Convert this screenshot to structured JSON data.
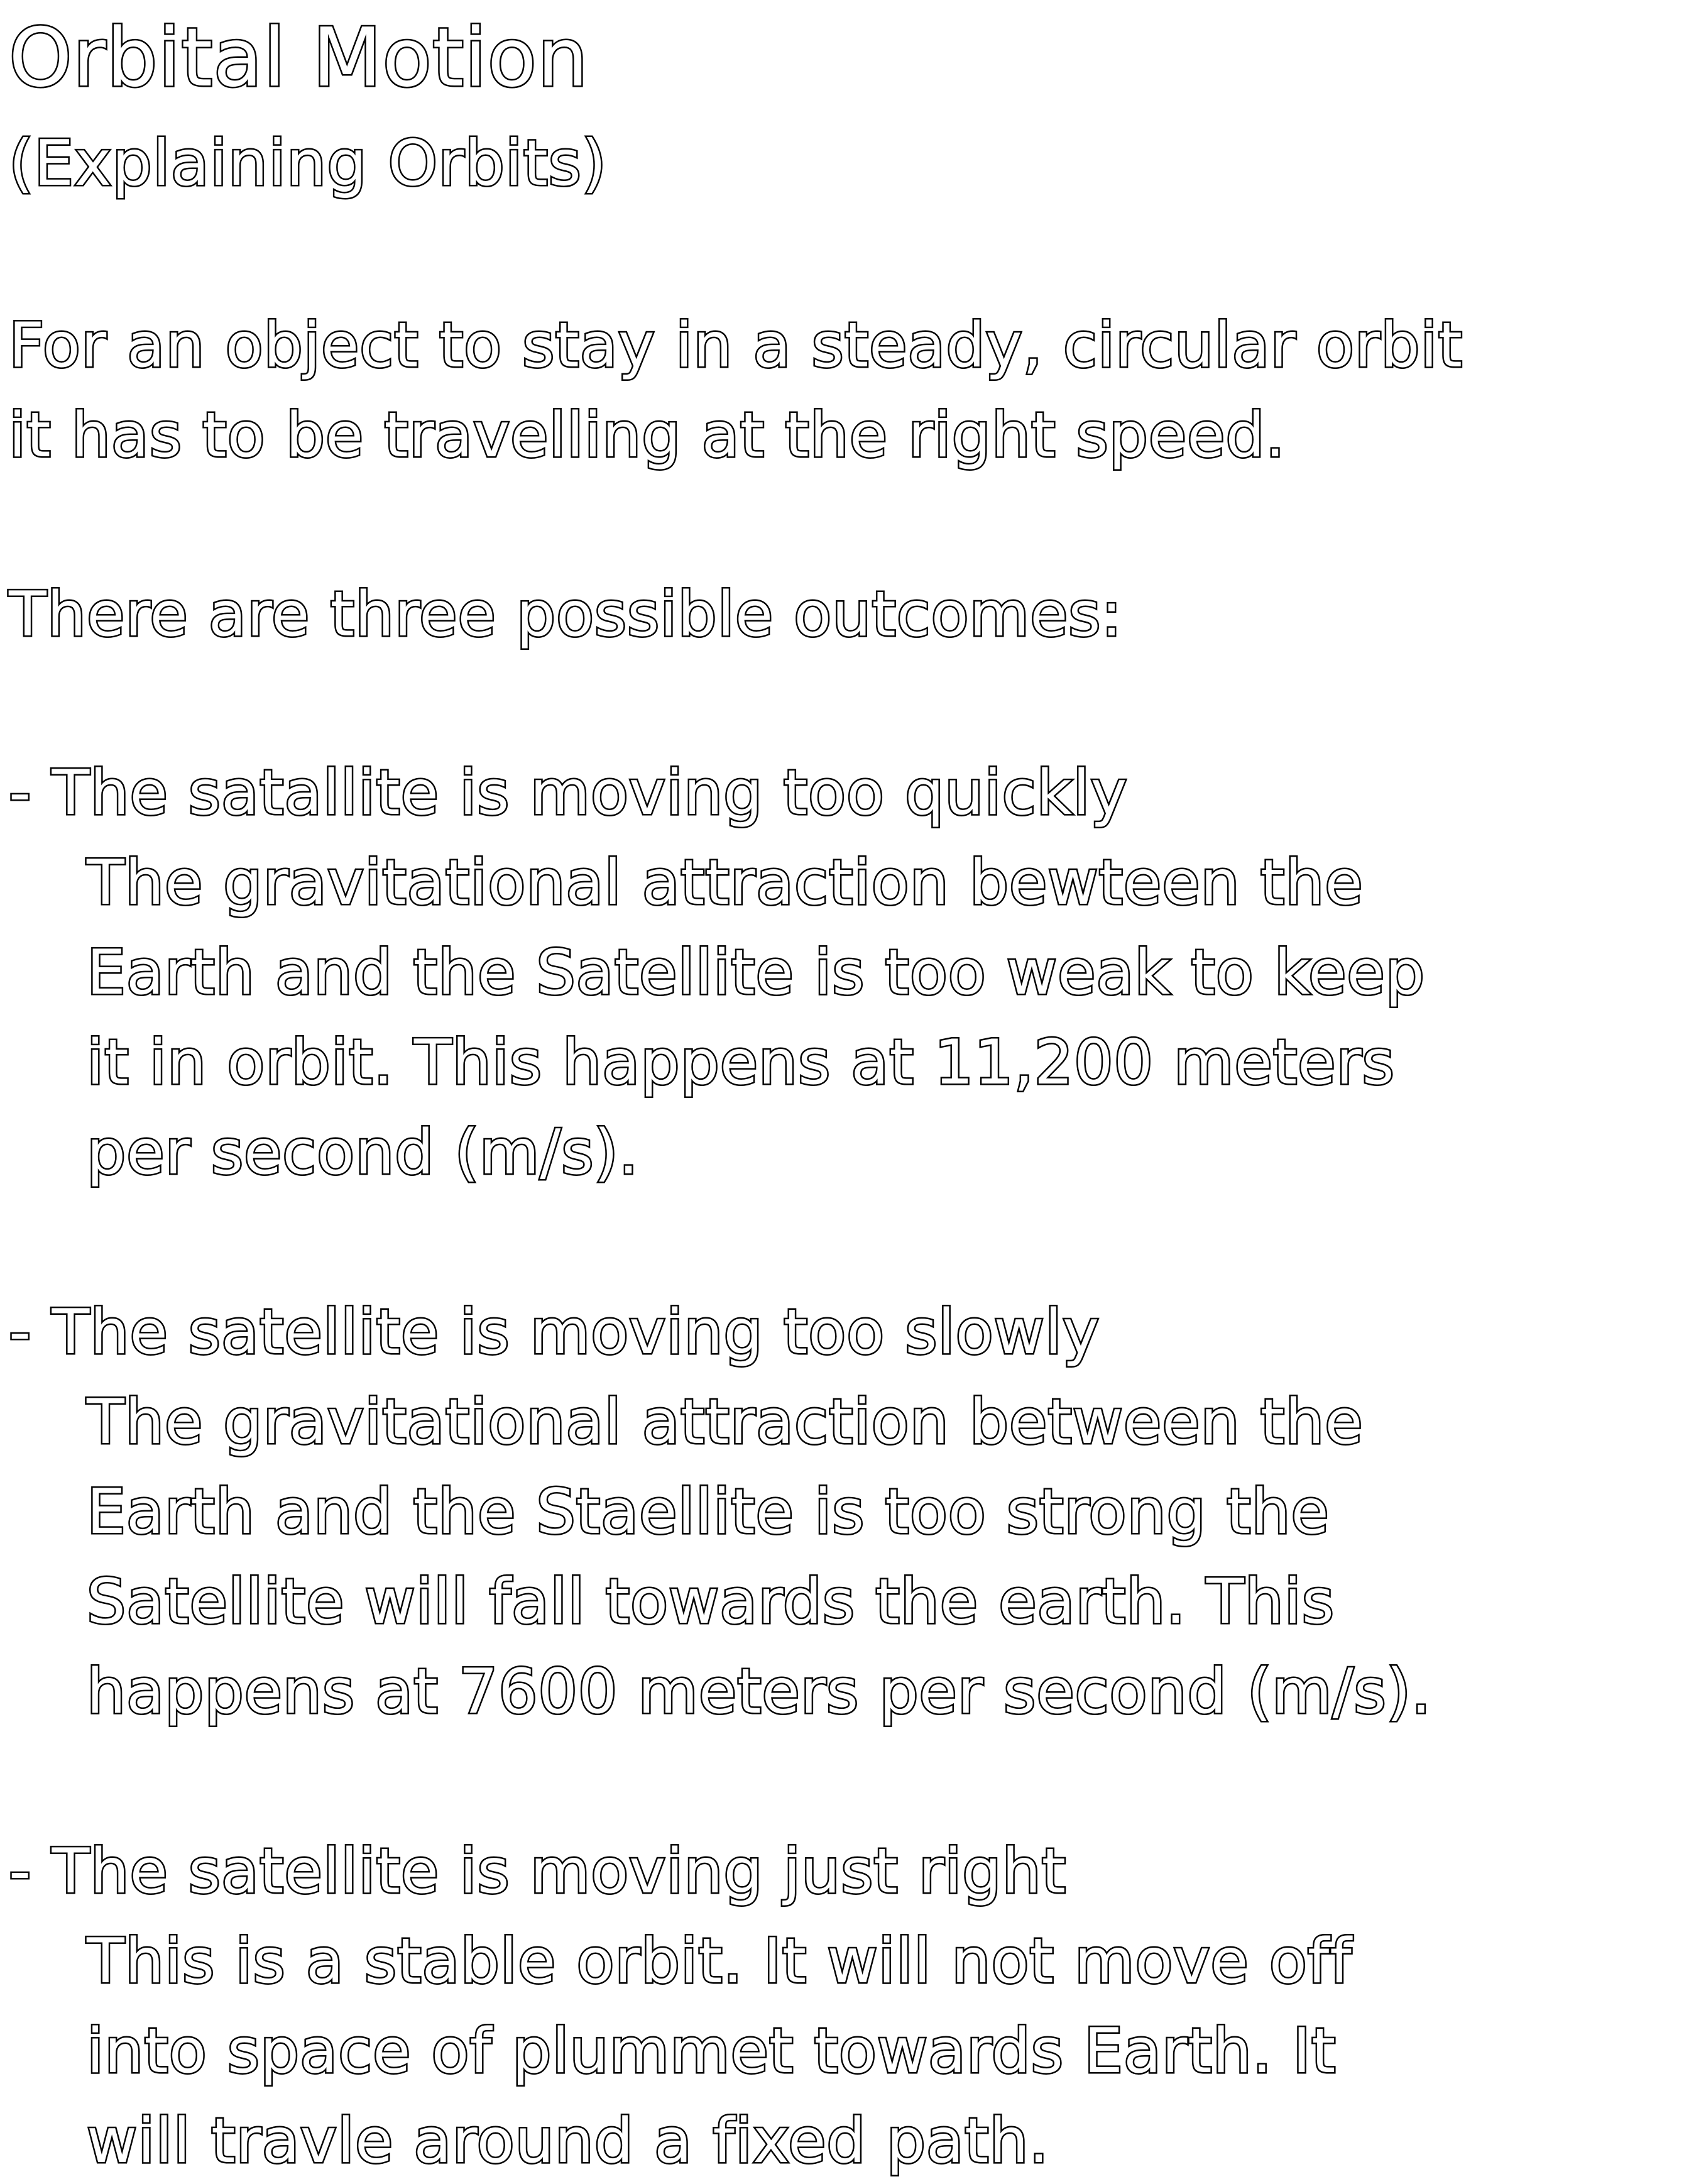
{
  "title": "Orbital Motion",
  "subtitle": "(Explaining Orbits)",
  "intro": [
    "For an object to stay in a steady, circular orbit",
    "it has to be travelling at the right speed."
  ],
  "outcomes_heading": "There are three possible outcomes:",
  "outcomes": [
    {
      "heading": "- The satallite is moving too quickly",
      "lines": [
        "The gravitational attraction bewteen the",
        "Earth and the Satellite is too weak to keep",
        "it in orbit. This happens at 11,200 meters",
        "per second (m/s)."
      ]
    },
    {
      "heading": "- The satellite is moving too slowly",
      "lines": [
        "The gravitational attraction between the",
        "Earth and the Staellite is too strong the",
        "Satellite will fall towards the earth. This",
        "happens at 7600 meters per second (m/s)."
      ]
    },
    {
      "heading": "- The satellite is moving just right",
      "lines": [
        "This is a stable orbit. It will not move off",
        "into space of plummet towards Earth. It",
        "will travle around a fixed path."
      ]
    }
  ]
}
